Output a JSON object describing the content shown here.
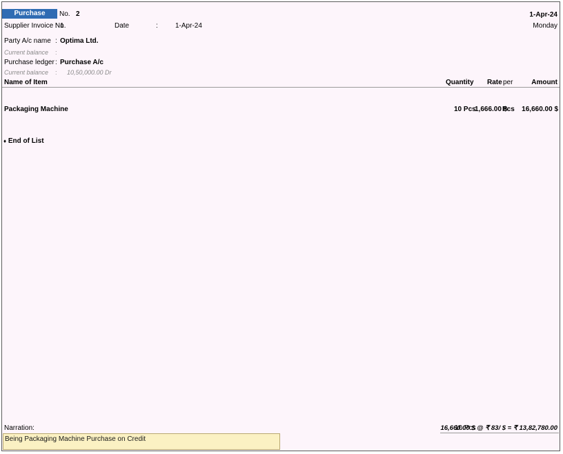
{
  "voucher": {
    "type": "Purchase",
    "no_label": "No.",
    "no_value": "2",
    "date_right": "1-Apr-24",
    "day": "Monday"
  },
  "supplier": {
    "invoice_label": "Supplier Invoice No.",
    "invoice_value": "1",
    "date_label": "Date",
    "date_value": "1-Apr-24"
  },
  "party": {
    "label": "Party A/c name",
    "value": "Optima Ltd.",
    "balance_label": "Current balance",
    "balance_value": ""
  },
  "ledger": {
    "label": "Purchase ledger",
    "value": "Purchase A/c",
    "balance_label": "Current balance",
    "balance_value": "10,50,000.00 Dr"
  },
  "columns": {
    "item": "Name of Item",
    "quantity": "Quantity",
    "rate": "Rate",
    "per": "per",
    "amount": "Amount"
  },
  "items": [
    {
      "name": "Packaging Machine",
      "quantity": "10 Pcs",
      "rate": "1,666.00 $",
      "per": "Pcs",
      "amount": "16,660.00 $"
    }
  ],
  "end_of_list": "End of List",
  "narration": {
    "label": "Narration:",
    "value": "Being Packaging Machine Purchase on Credit"
  },
  "totals": {
    "quantity": "10 Pcs",
    "amount": "16,660.00 $ @ ₹ 83/ $ = ₹ 13,82,780.00"
  }
}
